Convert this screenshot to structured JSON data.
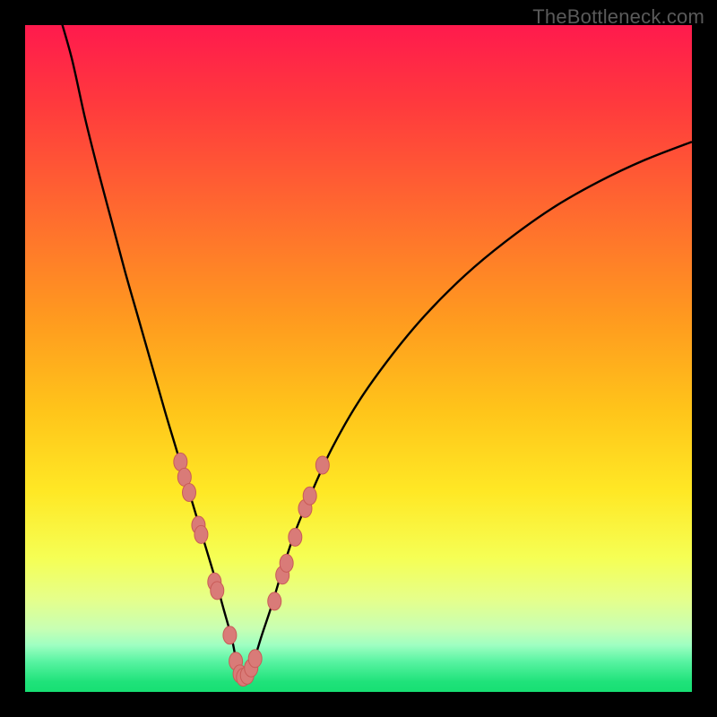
{
  "watermark": "TheBottleneck.com",
  "colors": {
    "frame": "#000000",
    "curve": "#000000",
    "dot_fill": "#d97b78",
    "dot_stroke": "#c95b57",
    "grad_stops": [
      {
        "offset": 0.0,
        "color": "#ff1a4d"
      },
      {
        "offset": 0.12,
        "color": "#ff3a3d"
      },
      {
        "offset": 0.28,
        "color": "#ff6a2f"
      },
      {
        "offset": 0.44,
        "color": "#ff9a1f"
      },
      {
        "offset": 0.58,
        "color": "#ffc51a"
      },
      {
        "offset": 0.7,
        "color": "#ffe825"
      },
      {
        "offset": 0.8,
        "color": "#f5ff55"
      },
      {
        "offset": 0.86,
        "color": "#e6ff8a"
      },
      {
        "offset": 0.905,
        "color": "#c8ffb3"
      },
      {
        "offset": 0.93,
        "color": "#9effc2"
      },
      {
        "offset": 0.955,
        "color": "#57f3a1"
      },
      {
        "offset": 0.985,
        "color": "#1fe27a"
      },
      {
        "offset": 1.0,
        "color": "#17df73"
      }
    ]
  },
  "chart_data": {
    "type": "line",
    "title": "",
    "xlabel": "",
    "ylabel": "",
    "xlim": [
      0,
      100
    ],
    "ylim": [
      0,
      100
    ],
    "series": [
      {
        "name": "bottleneck-curve",
        "x": [
          5,
          7,
          9,
          11,
          13,
          15,
          17,
          19,
          21,
          22.5,
          24,
          25.5,
          27,
          28.5,
          29.75,
          31,
          31.6,
          32.1,
          32.6,
          33.1,
          33.7,
          34.5,
          35.5,
          37,
          38.5,
          40.5,
          43,
          46,
          50,
          55,
          60,
          66,
          72,
          79,
          86,
          93,
          100
        ],
        "y": [
          102,
          95,
          86,
          78,
          70.5,
          63,
          56,
          49,
          42,
          37,
          32,
          27,
          22,
          17,
          12.5,
          8,
          5,
          3.3,
          2.3,
          2.3,
          3.3,
          5.3,
          8.5,
          13,
          18,
          24,
          30,
          36.5,
          43.5,
          50.5,
          56.5,
          62.5,
          67.5,
          72.5,
          76.5,
          79.8,
          82.5
        ]
      }
    ],
    "highlight_points": {
      "name": "curve-dots",
      "points": [
        {
          "x": 23.3,
          "y": 34.5
        },
        {
          "x": 23.9,
          "y": 32.2
        },
        {
          "x": 24.6,
          "y": 29.9
        },
        {
          "x": 26.0,
          "y": 25.0
        },
        {
          "x": 26.4,
          "y": 23.6
        },
        {
          "x": 28.4,
          "y": 16.5
        },
        {
          "x": 28.8,
          "y": 15.2
        },
        {
          "x": 30.7,
          "y": 8.5
        },
        {
          "x": 31.6,
          "y": 4.6
        },
        {
          "x": 32.2,
          "y": 2.7
        },
        {
          "x": 32.7,
          "y": 2.2
        },
        {
          "x": 33.3,
          "y": 2.5
        },
        {
          "x": 33.9,
          "y": 3.6
        },
        {
          "x": 34.5,
          "y": 5.0
        },
        {
          "x": 37.4,
          "y": 13.6
        },
        {
          "x": 38.6,
          "y": 17.5
        },
        {
          "x": 39.2,
          "y": 19.3
        },
        {
          "x": 40.5,
          "y": 23.2
        },
        {
          "x": 42.0,
          "y": 27.5
        },
        {
          "x": 42.7,
          "y": 29.4
        },
        {
          "x": 44.6,
          "y": 34.0
        }
      ]
    }
  }
}
